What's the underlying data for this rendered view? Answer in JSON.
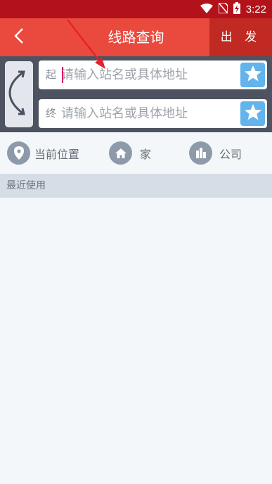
{
  "status_bar": {
    "time": "3:22",
    "icons": [
      "wifi-icon",
      "no-sim-icon",
      "battery-charging-icon"
    ]
  },
  "header": {
    "back_icon": "back-arrow-icon",
    "title": "线路查询",
    "go_label": "出 发"
  },
  "route_form": {
    "start": {
      "label": "起",
      "placeholder": "请输入站名或具体地址",
      "value": ""
    },
    "end": {
      "label": "终",
      "placeholder": "请输入站名或具体地址",
      "value": ""
    },
    "swap_icon": "swap-arrows-icon",
    "favorite_icon": "star-icon"
  },
  "shortcuts": [
    {
      "label": "当前位置",
      "icon": "location-pin-icon"
    },
    {
      "label": "家",
      "icon": "home-icon"
    },
    {
      "label": "公司",
      "icon": "office-building-icon"
    }
  ],
  "recent": {
    "title": "最近使用"
  },
  "colors": {
    "status_bar": "#b3121a",
    "title_bar": "#ea4a3d",
    "go_button": "#c02a22",
    "panel": "#4d5360",
    "favorite": "#63b3ec",
    "annotation_arrow": "#e8202a"
  }
}
